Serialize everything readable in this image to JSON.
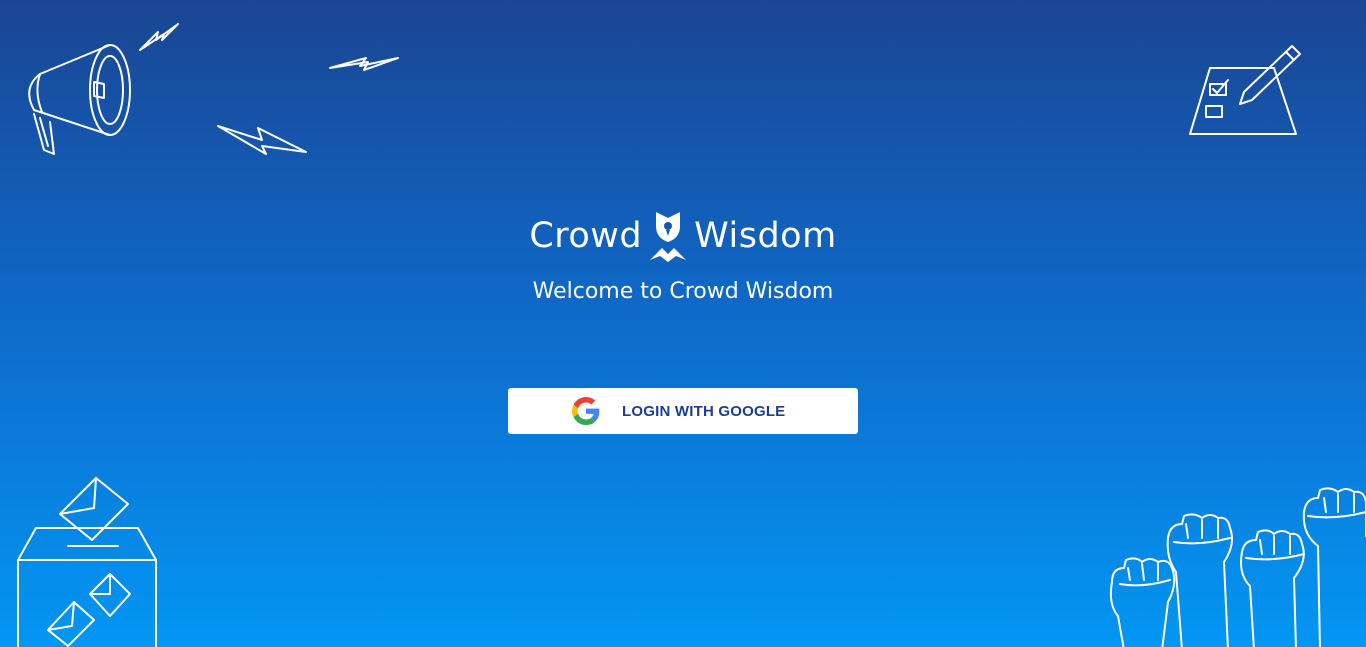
{
  "brand": {
    "name_left": "Crowd",
    "name_right": "Wisdom",
    "logo_icon": "owl-mark-icon"
  },
  "welcome_text": "Welcome to Crowd Wisdom",
  "login": {
    "label": "LOGIN WITH GOOGLE",
    "icon": "google-g-icon"
  },
  "decorations": [
    "megaphone-icon",
    "lightning-bolt-icon",
    "ballot-checklist-icon",
    "ballot-box-icon",
    "raised-fists-icon"
  ],
  "colors": {
    "background_top": "#1a4593",
    "background_bottom": "#0396f3",
    "button_text": "#1b3f8f"
  }
}
